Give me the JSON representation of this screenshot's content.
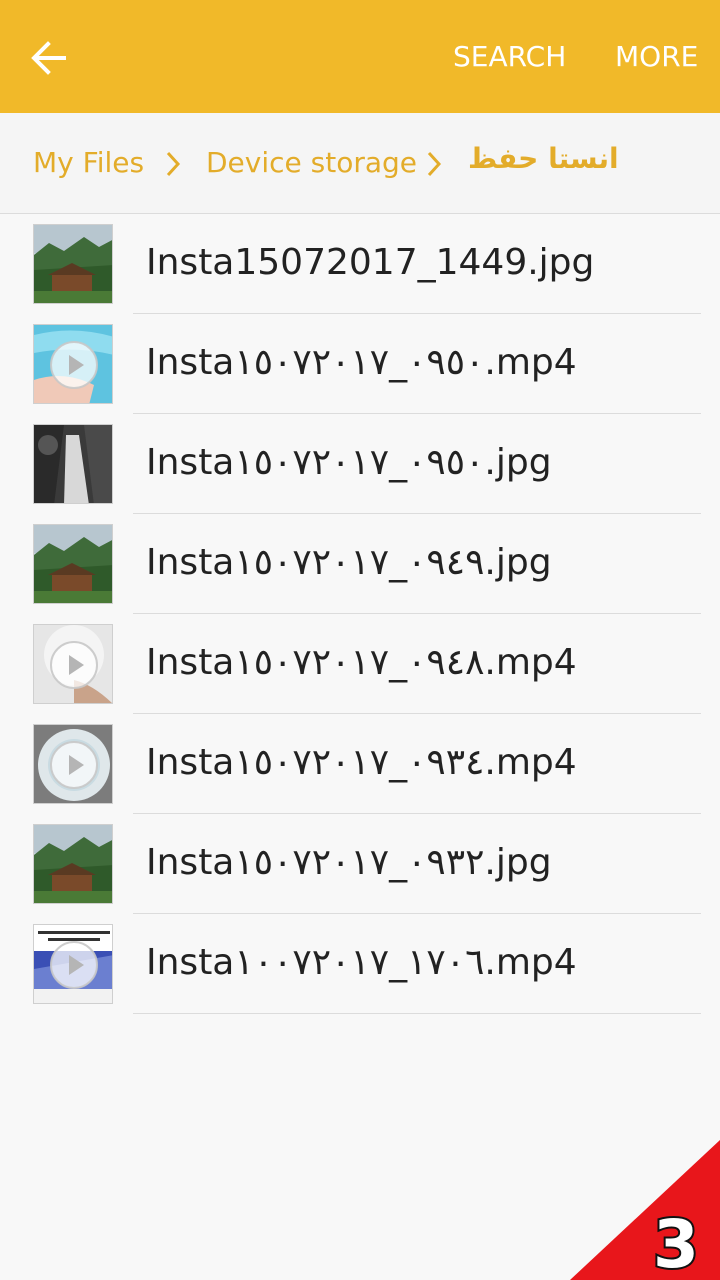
{
  "appbar": {
    "back_icon": "arrow-back-icon",
    "search_label": "SEARCH",
    "more_label": "MORE",
    "color": "#f1b929"
  },
  "breadcrumb": {
    "items": [
      "My Files",
      "Device storage",
      "انستا حفظ"
    ],
    "separator_icon": "chevron-right-icon",
    "color": "#e3ac2a"
  },
  "files": [
    {
      "name": "Insta15072017_1449.jpg",
      "type": "image",
      "thumb": "house"
    },
    {
      "name": "Insta٠٩٥٠_١٥٠٧٢٠١٧.mp4",
      "type": "video",
      "thumb": "water"
    },
    {
      "name": "Insta٠٩٥٠_١٥٠٧٢٠١٧.jpg",
      "type": "image",
      "thumb": "waterfall"
    },
    {
      "name": "Insta٠٩٤٩_١٥٠٧٢٠١٧.jpg",
      "type": "image",
      "thumb": "house"
    },
    {
      "name": "Insta٠٩٤٨_١٥٠٧٢٠١٧.mp4",
      "type": "video",
      "thumb": "white"
    },
    {
      "name": "Insta٠٩٣٤_١٥٠٧٢٠١٧.mp4",
      "type": "video",
      "thumb": "bowl"
    },
    {
      "name": "Insta٠٩٣٢_١٥٠٧٢٠١٧.jpg",
      "type": "image",
      "thumb": "house"
    },
    {
      "name": "Insta١٧٠٦_١٠٠٧٢٠١٧.mp4",
      "type": "video",
      "thumb": "text"
    }
  ],
  "corner_badge": {
    "label": "3",
    "color": "#e8161b"
  }
}
